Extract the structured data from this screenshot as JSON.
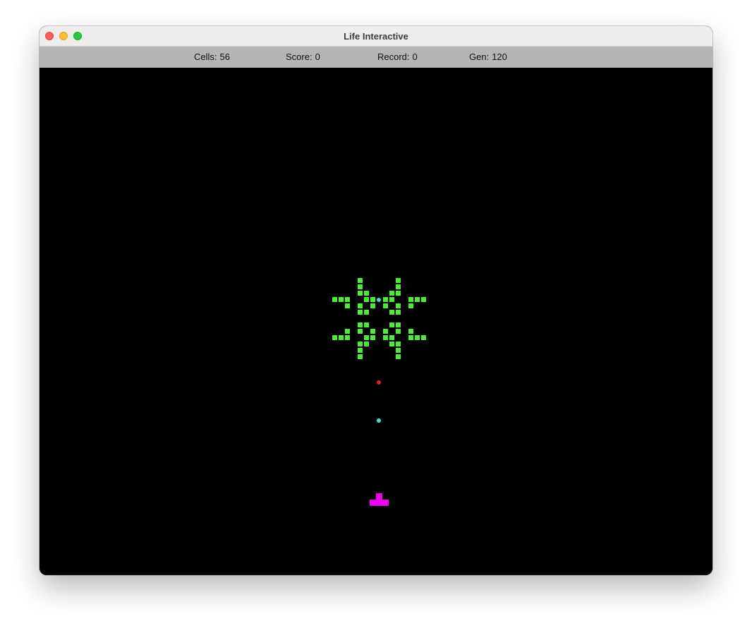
{
  "window": {
    "title": "Life Interactive",
    "close_icon": "close-icon",
    "minimize_icon": "minimize-icon",
    "zoom_icon": "zoom-icon"
  },
  "status": {
    "cells_label": "Cells:",
    "cells_value": "56",
    "score_label": "Score:",
    "score_value": "0",
    "record_label": "Record:",
    "record_value": "0",
    "gen_label": "Gen:",
    "gen_value": "120"
  },
  "colors": {
    "cell": "#4eea3a",
    "player_ship": "#ec00ec",
    "player_bullet": "#40e0d0",
    "enemy_bullet": "#e02020",
    "board_background": "#000000",
    "status_bar": "#b5b5b5"
  }
}
